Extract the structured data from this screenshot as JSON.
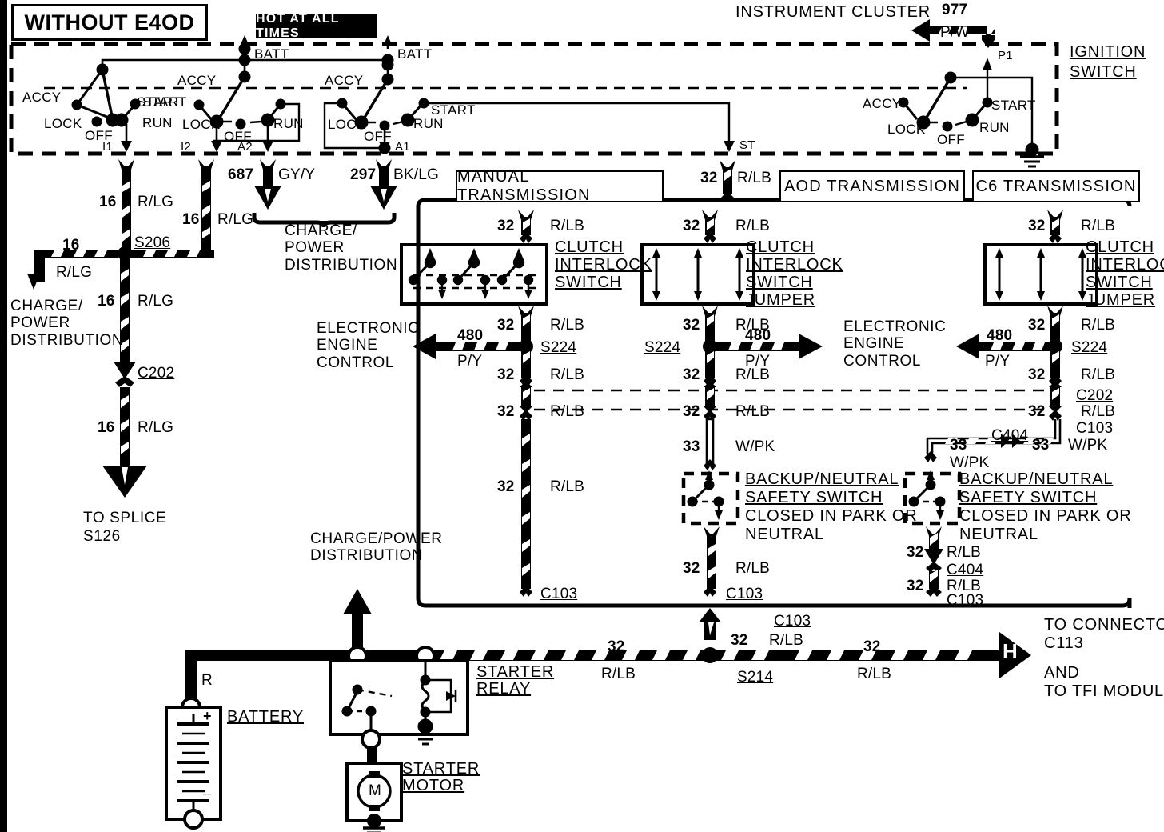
{
  "diagram": {
    "title": "WITHOUT E4OD",
    "hot_banner": "HOT AT ALL TIMES",
    "instrument_cluster": "INSTRUMENT CLUSTER",
    "ignition_switch_line1": "IGNITION",
    "ignition_switch_line2": "SWITCH"
  },
  "ignition_switches": [
    {
      "id": "sw1",
      "positions": [
        "ACCY",
        "LOCK",
        "OFF",
        "RUN",
        "START"
      ],
      "batt": "BATT",
      "terminal": "I1"
    },
    {
      "id": "sw2",
      "positions": [
        "ACCY",
        "LOCK",
        "OFF",
        "RUN",
        "START"
      ],
      "batt": "BATT",
      "terminal": "I2",
      "terminal2": "A2"
    },
    {
      "id": "sw3",
      "positions": [
        "ACCY",
        "LOCK",
        "OFF",
        "RUN",
        "START"
      ],
      "terminal": "A1",
      "terminal2": "ST"
    },
    {
      "id": "sw4",
      "positions": [
        "ACCY",
        "LOCK",
        "OFF",
        "RUN",
        "START"
      ],
      "terminal": "P1"
    }
  ],
  "wires": {
    "w977": {
      "num": "977",
      "color": "P/W"
    },
    "w687": {
      "num": "687",
      "color": "GY/Y"
    },
    "w297": {
      "num": "297",
      "color": "BK/LG"
    },
    "rlg_top": {
      "num": "16",
      "color": "R/LG"
    },
    "rlg_top2": {
      "num": "16",
      "color": "R/LG"
    },
    "rlg_left": {
      "num": "16",
      "color": "R/LG"
    },
    "rlg_mid": {
      "num": "16",
      "color": "R/LG"
    },
    "rlg_bot": {
      "num": "16",
      "color": "R/LG"
    },
    "rlb": {
      "num": "32",
      "color": "R/LB"
    },
    "wpk": {
      "num": "33",
      "color": "W/PK"
    },
    "py": {
      "num": "480",
      "color": "P/Y"
    },
    "battery_feed": {
      "color": "R"
    }
  },
  "connectors": {
    "s206": "S206",
    "s224": "S224",
    "s214": "S214",
    "c202": "C202",
    "c103": "C103",
    "c404": "C404",
    "s126_line1": "TO SPLICE",
    "s126_line2": "S126"
  },
  "labels": {
    "charge_power_left": "CHARGE/\nPOWER\nDISTRIBUTION",
    "charge_power_top": "CHARGE/\nPOWER\nDISTRIBUTION",
    "charge_power_bottom": "CHARGE/POWER\nDISTRIBUTION",
    "eec": "ELECTRONIC\nENGINE\nCONTROL",
    "clutch_interlock_switch": [
      "CLUTCH",
      "INTERLOCK",
      "SWITCH"
    ],
    "clutch_interlock_jumper": [
      "CLUTCH",
      "INTERLOCK",
      "SWITCH",
      "JUMPER"
    ],
    "backup_neutral_1": "BACKUP/NEUTRAL",
    "backup_neutral_2": "SAFETY SWITCH",
    "backup_neutral_3": "CLOSED IN PARK OR",
    "backup_neutral_4": "NEUTRAL",
    "battery": "BATTERY",
    "starter_relay": [
      "STARTER",
      "RELAY"
    ],
    "starter_motor": [
      "STARTER",
      "MOTOR"
    ],
    "to_connector_1": "TO CONNECTOR",
    "to_connector_2": "C113",
    "to_connector_3": "AND",
    "to_connector_4": "TO TFI MODULE",
    "h_marker": "H",
    "motor_marker": "M",
    "battery_plus": "+",
    "battery_minus": "_"
  },
  "transmission_boxes": [
    {
      "id": "manual",
      "label": "MANUAL TRANSMISSION"
    },
    {
      "id": "aod",
      "label": "AOD TRANSMISSION"
    },
    {
      "id": "c6",
      "label": "C6 TRANSMISSION"
    }
  ],
  "colors": {
    "ink": "#000000",
    "paper": "#ffffff"
  }
}
